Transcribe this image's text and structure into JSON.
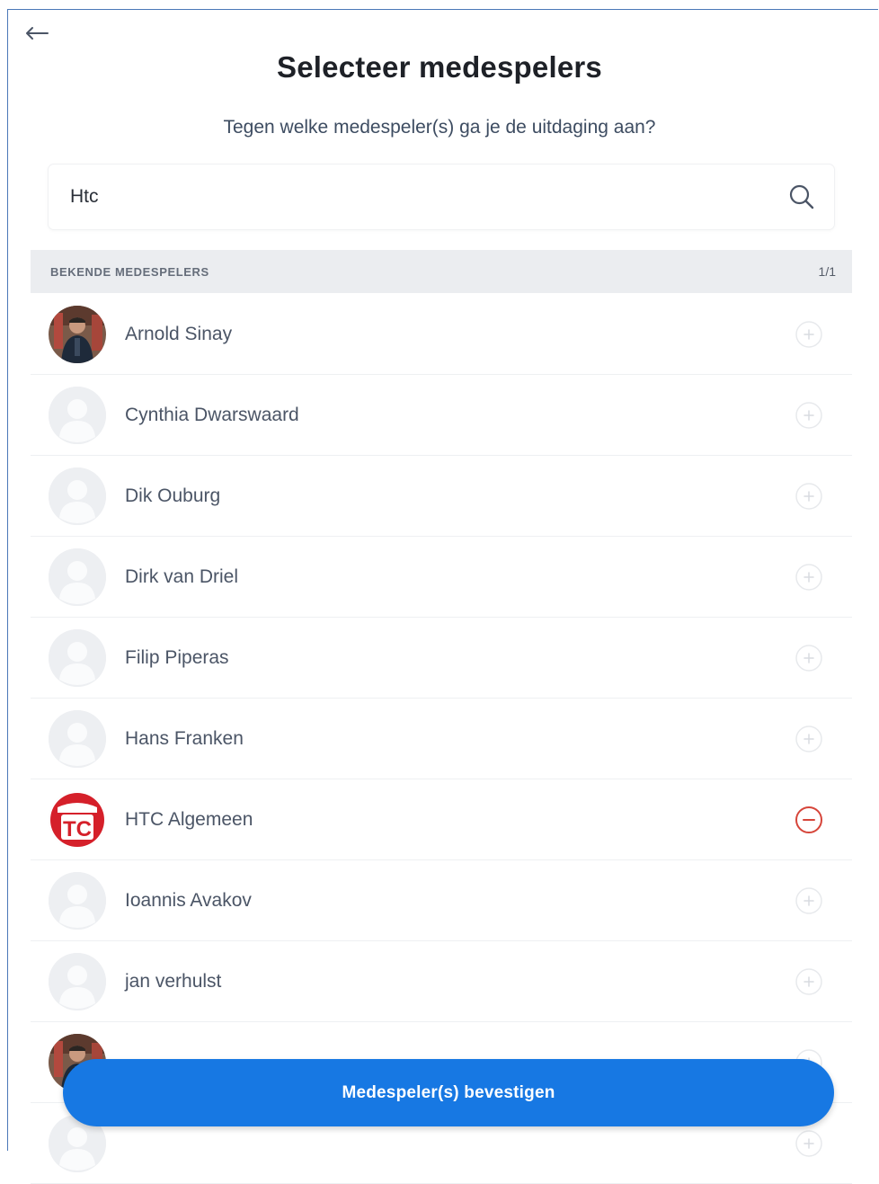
{
  "header": {
    "title": "Selecteer medespelers",
    "subtitle": "Tegen welke medespeler(s) ga je de uitdaging aan?"
  },
  "search": {
    "value": "Htc",
    "placeholder": ""
  },
  "section": {
    "label": "BEKENDE MEDESPELERS",
    "count": "1/1"
  },
  "players": [
    {
      "name": "Arnold Sinay",
      "avatar": "photo",
      "selected": false
    },
    {
      "name": "Cynthia Dwarswaard",
      "avatar": "placeholder",
      "selected": false
    },
    {
      "name": "Dik Ouburg",
      "avatar": "placeholder",
      "selected": false
    },
    {
      "name": "Dirk van Driel",
      "avatar": "placeholder",
      "selected": false
    },
    {
      "name": "Filip Piperas",
      "avatar": "placeholder",
      "selected": false
    },
    {
      "name": "Hans Franken",
      "avatar": "placeholder",
      "selected": false
    },
    {
      "name": "HTC Algemeen",
      "avatar": "htc-logo",
      "selected": true
    },
    {
      "name": "Ioannis Avakov",
      "avatar": "placeholder",
      "selected": false
    },
    {
      "name": "jan verhulst",
      "avatar": "placeholder",
      "selected": false
    },
    {
      "name": "",
      "avatar": "photo-partial",
      "selected": false
    },
    {
      "name": "",
      "avatar": "placeholder",
      "selected": false
    }
  ],
  "confirm_button": {
    "label": "Medespeler(s) bevestigen"
  },
  "colors": {
    "primary": "#1778e3",
    "selected_remove": "#d6453a",
    "section_bg": "#ebedf0"
  },
  "icons": {
    "back": "arrow-left-icon",
    "search": "search-icon",
    "add": "plus-circle-icon",
    "remove": "minus-circle-icon"
  }
}
